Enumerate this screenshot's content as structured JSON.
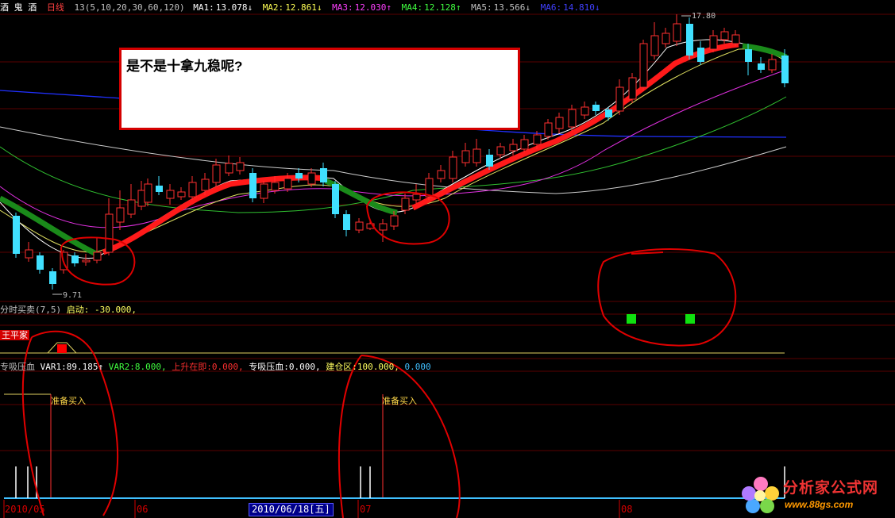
{
  "header": {
    "stock_name": "酒 鬼 酒",
    "period": "日线",
    "ma_params": "13(5,10,20,30,60,120)",
    "ma1": {
      "label": "MA1:",
      "value": "13.078↓",
      "color": "#ffffff"
    },
    "ma2": {
      "label": "MA2:",
      "value": "12.861↓",
      "color": "#ffff55"
    },
    "ma3": {
      "label": "MA3:",
      "value": "12.030↑",
      "color": "#ff40ff"
    },
    "ma4": {
      "label": "MA4:",
      "value": "12.128↑",
      "color": "#40ff40"
    },
    "ma5": {
      "label": "MA5:",
      "value": "13.566↓",
      "color": "#c0c0c0"
    },
    "ma6": {
      "label": "MA6:",
      "value": "14.810↓",
      "color": "#4040ff"
    }
  },
  "price_markers": {
    "high": "17.80",
    "low": "9.71"
  },
  "callout": {
    "text": "是不是十拿九稳呢?"
  },
  "indicator1": {
    "title": "分时买卖(7,5)",
    "param_label": "启动:",
    "param_value": "-30.000,"
  },
  "indicator2": {
    "title": "王平家"
  },
  "indicator3": {
    "title": "专吸压血",
    "var1_label": "VAR1:",
    "var1_value": "89.185↑",
    "var2_label": "VAR2:",
    "var2_value": "8.000,",
    "up_label": "上升在即:",
    "up_value": "0.000,",
    "suck_label": "专吸压血:",
    "suck_value": "0.000,",
    "build_label": "建仓区:",
    "build_value": "100.000,",
    "last_value": "0.000"
  },
  "signals": {
    "ready_buy_1": "准备买入",
    "ready_buy_2": "准备买入"
  },
  "time_axis": {
    "labels": [
      "2010/05",
      "06",
      "07",
      "08"
    ],
    "selected_date": "2010/06/18[五]"
  },
  "logo": {
    "title": "分析家公式网",
    "url": "www.88gs.com"
  },
  "colors": {
    "up": "#ff3030",
    "down": "#40e0ff",
    "background": "#000000",
    "annotation": "#e00000"
  }
}
